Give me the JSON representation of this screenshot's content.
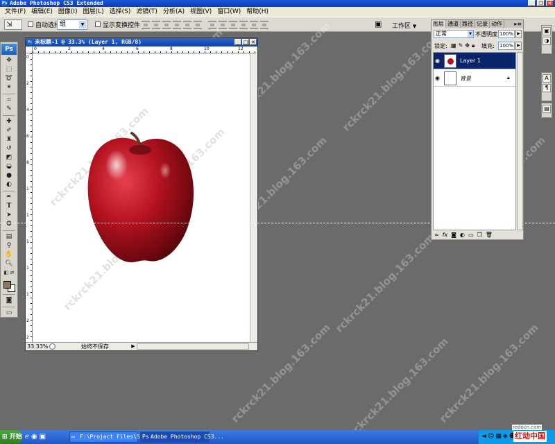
{
  "app": {
    "title": "Adobe Photoshop CS3 Extended",
    "ps_badge": "Ps"
  },
  "menu": [
    "文件(F)",
    "编辑(E)",
    "图像(I)",
    "图层(L)",
    "选择(S)",
    "滤镜(T)",
    "分析(A)",
    "视图(V)",
    "窗口(W)",
    "帮助(H)"
  ],
  "options": {
    "auto_select_label": "自动选择:",
    "auto_select_value": "组",
    "show_transform_label": "显示变换控件",
    "workspace_label": "工作区"
  },
  "document": {
    "title": "未标题-1 @ 33.3% (Layer 1, RGB/8)",
    "zoom": "33.33%",
    "status_message": "始终不保存",
    "ruler_top": [
      "0",
      "2",
      "4",
      "6",
      "8",
      "10",
      "12"
    ],
    "ruler_left": [
      "0",
      "2",
      "4",
      "6",
      "8",
      "1",
      "1",
      "1",
      "1",
      "1",
      "2",
      "2"
    ]
  },
  "layers_panel": {
    "tabs": [
      "图层",
      "通道",
      "路径",
      "记录",
      "动作"
    ],
    "blend_mode": "正常",
    "opacity_label": "不透明度:",
    "opacity_value": "100%",
    "lock_label": "锁定:",
    "fill_label": "填充:",
    "fill_value": "100%",
    "layers": [
      {
        "name": "Layer 1",
        "selected": true
      },
      {
        "name": "背景",
        "selected": false,
        "locked": true
      }
    ],
    "bottom_icons": [
      "link-icon",
      "fx-icon",
      "mask-icon",
      "adjustment-icon",
      "group-icon",
      "new-layer-icon",
      "trash-icon"
    ]
  },
  "watermark": "rckrck21.blog.163.com",
  "taskbar": {
    "start_label": "开始",
    "items": [
      {
        "label": "F:\\Project Files\\Sq...",
        "active": false
      },
      {
        "label": "Adobe Photoshop CS3...",
        "active": true
      }
    ]
  },
  "branding": {
    "site": "redocn.com",
    "name": "红动中国"
  },
  "colors": {
    "workspace_bg": "#6b6b6b",
    "title_blue": "#0a3bbf",
    "selected_layer": "#0a246a",
    "foreground_color": "#8a7860",
    "apple_red": "#b01020"
  }
}
